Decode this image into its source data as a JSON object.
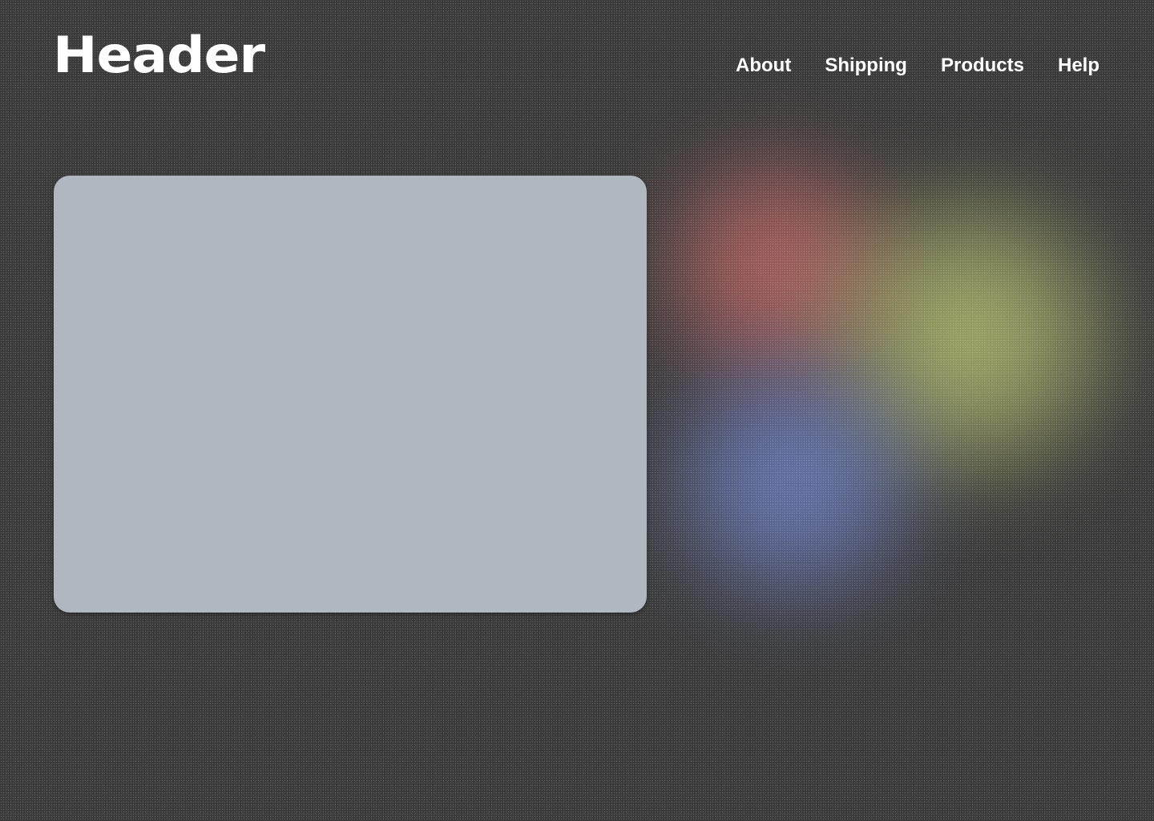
{
  "header": {
    "title": "Header"
  },
  "nav": {
    "items": [
      {
        "label": "About"
      },
      {
        "label": "Shipping"
      },
      {
        "label": "Products"
      },
      {
        "label": "Help"
      }
    ]
  },
  "colors": {
    "background": "#3b3b3b",
    "card": "#b0b7bf",
    "text": "#ffffff",
    "orb_red": "#d66e6e",
    "orb_yellow": "#c8d278",
    "orb_blue": "#788cdc"
  }
}
